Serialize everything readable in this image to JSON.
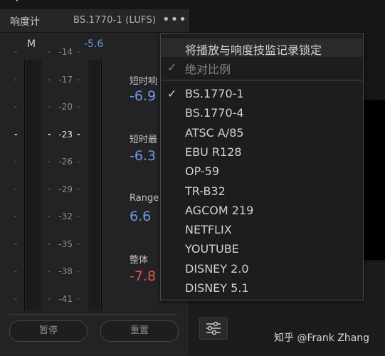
{
  "top_fragment": "✓",
  "panel": {
    "title": "响度计",
    "standard": "BS.1770-1 (LUFS)",
    "more_icon": "•••",
    "channel_label": "M",
    "peak_value": "-5.6"
  },
  "scale": {
    "values": [
      "-14",
      "-17",
      "-20",
      "-23",
      "-26",
      "-29",
      "-32",
      "-35",
      "-38",
      "-41"
    ],
    "major": "-23"
  },
  "stats": {
    "short_term_label": "短时响",
    "short_term_value": "-6.9",
    "short_term_max_label": "短时最",
    "short_term_max_value": "-6.3",
    "range_label": "Range",
    "range_value": "6.6",
    "integrated_label": "整体",
    "integrated_value": "-7.8"
  },
  "buttons": {
    "pause": "暂停",
    "reset": "重置"
  },
  "menu": {
    "lock_item": "将播放与响度技监记录锁定",
    "absolute_item": "绝对比例",
    "standards": [
      "BS.1770-1",
      "BS.1770-4",
      "ATSC A/85",
      "EBU R128",
      "OP-59",
      "TR-B32",
      "AGCOM 219",
      "NETFLIX",
      "YOUTUBE",
      "DISNEY 2.0",
      "DISNEY 5.1"
    ],
    "selected": "BS.1770-1",
    "check_glyph": "✓"
  },
  "watermark": "知乎 @Frank Zhang",
  "colors": {
    "accent_blue": "#6e98e0",
    "negative_red": "#e0544b"
  }
}
